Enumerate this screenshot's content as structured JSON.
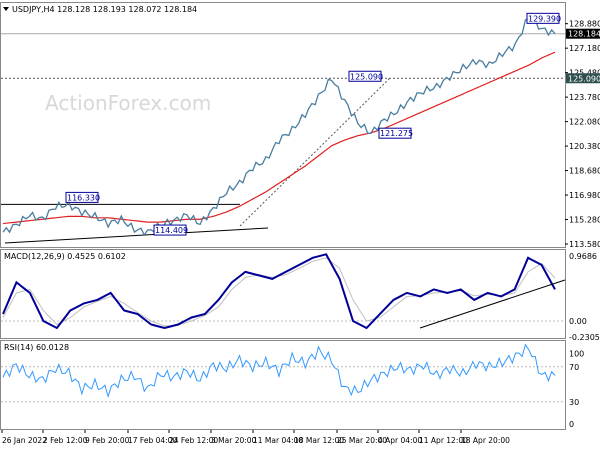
{
  "chart_data": [
    {
      "type": "line",
      "title": "USDJPY,H4 128.128 128.193 128.072 128.184",
      "symbol": "USDJPY,H4",
      "ohlc": {
        "open": 128.128,
        "high": 128.193,
        "low": 128.072,
        "close": 128.184
      },
      "y_ticks": [
        "128.880",
        "127.180",
        "125.480",
        "123.780",
        "122.080",
        "120.380",
        "118.680",
        "116.980",
        "115.280",
        "113.580"
      ],
      "ylim": [
        113.58,
        129.9
      ],
      "x_ticks": [
        "26 Jan 2022",
        "2 Feb 12:00",
        "9 Feb 20:00",
        "17 Feb 04:00",
        "24 Feb 12:00",
        "3 Mar 20:00",
        "11 Mar 04:00",
        "18 Mar 12:00",
        "25 Mar 20:00",
        "4 Apr 04:00",
        "11 Apr 12:00",
        "18 Apr 20:00"
      ],
      "series": [
        {
          "values": [
            114.4,
            114.9,
            115.6,
            115.3,
            116.2,
            116.3,
            115.8,
            115.5,
            115.0,
            115.3,
            114.6,
            114.4,
            114.9,
            115.2,
            115.6,
            115.0,
            116.0,
            117.2,
            117.8,
            118.9,
            119.4,
            120.8,
            121.5,
            122.6,
            123.8,
            125.09,
            123.5,
            122.0,
            121.27,
            122.2,
            122.8,
            123.6,
            124.2,
            124.5,
            125.2,
            125.8,
            126.3,
            126.0,
            126.8,
            127.4,
            129.39,
            128.5,
            128.184
          ],
          "color": "#4a7ea0"
        },
        {
          "values": [
            115.0,
            115.1,
            115.2,
            115.3,
            115.4,
            115.5,
            115.5,
            115.4,
            115.4,
            115.3,
            115.2,
            115.1,
            115.1,
            115.2,
            115.3,
            115.3,
            115.5,
            115.8,
            116.2,
            116.7,
            117.2,
            117.8,
            118.4,
            119.0,
            119.7,
            120.4,
            120.8,
            121.1,
            121.3,
            121.6,
            122.0,
            122.4,
            122.8,
            123.2,
            123.6,
            124.0,
            124.4,
            124.8,
            125.2,
            125.6,
            126.0,
            126.5,
            126.9
          ],
          "color": "#e02020"
        }
      ],
      "annotations": [
        "116.330",
        "114.409",
        "125.090",
        "121.275",
        "129.390"
      ],
      "current_price": "128.184",
      "level_price": "125.090",
      "watermark": "ActionForex.com"
    },
    {
      "type": "line",
      "title": "MACD(12,26,9) 0.4525 0.6102",
      "y_ticks": [
        "0.9686",
        "0.00",
        "-0.2305"
      ],
      "ylim": [
        -0.2305,
        0.9686
      ],
      "series": [
        {
          "values": [
            0.1,
            0.55,
            0.4,
            0.0,
            -0.1,
            0.15,
            0.25,
            0.3,
            0.4,
            0.15,
            0.1,
            -0.05,
            -0.1,
            -0.05,
            0.05,
            0.1,
            0.3,
            0.55,
            0.7,
            0.65,
            0.6,
            0.7,
            0.8,
            0.9,
            0.95,
            0.6,
            0.0,
            -0.1,
            0.1,
            0.3,
            0.4,
            0.35,
            0.45,
            0.4,
            0.45,
            0.3,
            0.4,
            0.35,
            0.45,
            0.9,
            0.8,
            0.45
          ],
          "color": "#000099"
        },
        {
          "values": [
            0.05,
            0.4,
            0.45,
            0.15,
            -0.05,
            0.05,
            0.2,
            0.28,
            0.35,
            0.25,
            0.12,
            0.0,
            -0.07,
            -0.06,
            0.0,
            0.08,
            0.2,
            0.45,
            0.62,
            0.66,
            0.62,
            0.66,
            0.75,
            0.85,
            0.9,
            0.75,
            0.3,
            0.0,
            0.05,
            0.2,
            0.35,
            0.36,
            0.4,
            0.41,
            0.43,
            0.36,
            0.38,
            0.36,
            0.4,
            0.7,
            0.82,
            0.61
          ],
          "color": "#c0c0c0"
        }
      ]
    },
    {
      "type": "line",
      "title": "RSI(14) 60.0128",
      "y_ticks": [
        "100",
        "70",
        "30",
        "0"
      ],
      "ylim": [
        0,
        100
      ],
      "series": [
        {
          "values": [
            58,
            72,
            60,
            55,
            68,
            63,
            45,
            50,
            42,
            55,
            60,
            44,
            62,
            58,
            65,
            55,
            72,
            68,
            78,
            70,
            75,
            65,
            80,
            74,
            88,
            78,
            45,
            42,
            55,
            62,
            70,
            66,
            72,
            60,
            68,
            62,
            74,
            70,
            75,
            82,
            92,
            60,
            60
          ],
          "color": "#3399ff"
        }
      ]
    }
  ]
}
